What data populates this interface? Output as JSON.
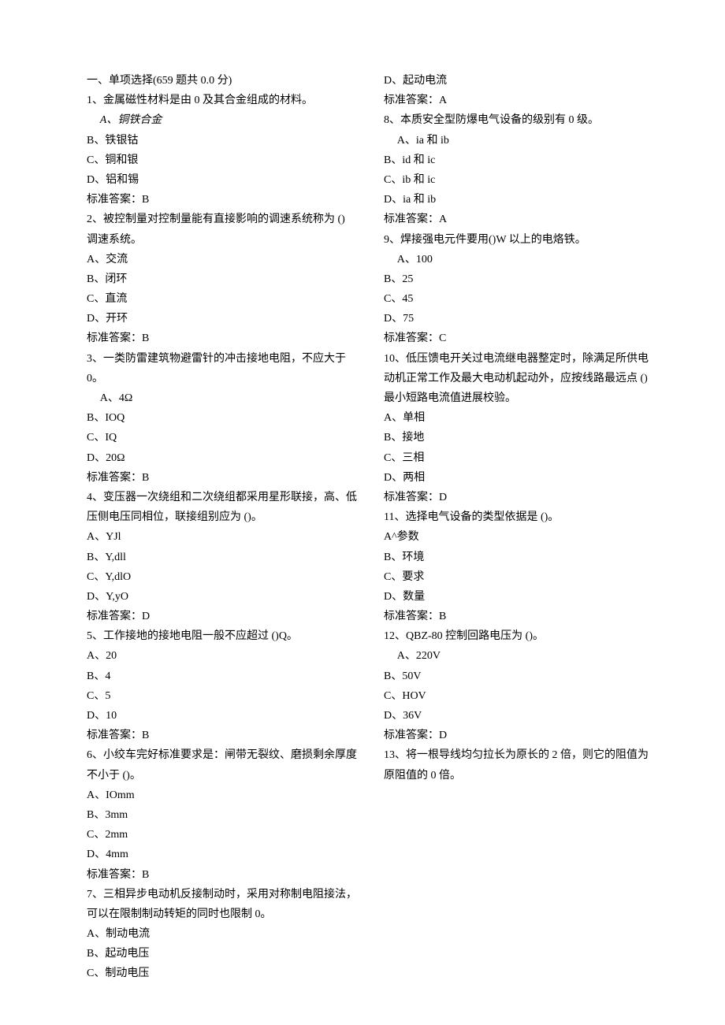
{
  "header": "一、单项选择(659 题共 0.0 分)",
  "questions": [
    {
      "stem": "1、金属磁性材料是由 0 及其合金组成的材料。",
      "options": [
        "A、铜铁合金",
        "B、铁银钴",
        "C、铜和银",
        "D、铝和锡"
      ],
      "first_indent": true,
      "first_italic": true,
      "answer": "标准答案：B"
    },
    {
      "stem": "2、被控制量对控制量能有直接影响的调速系统称为 () 调速系统。",
      "options": [
        "A、交流",
        "B、闭环",
        "C、直流",
        "D、开环"
      ],
      "answer": "标准答案：B"
    },
    {
      "stem": "3、一类防雷建筑物避雷针的冲击接地电阻，不应大于 0。",
      "options": [
        "A、4Ω",
        "B、IOQ",
        "C、IQ",
        "D、20Ω"
      ],
      "first_indent": true,
      "answer": "标准答案：B"
    },
    {
      "stem": "4、变压器一次绕组和二次绕组都采用星形联接，高、低压侧电压同相位，联接组别应为 ()。",
      "options": [
        "A、YJl",
        "B、Y,dll",
        "C、Y,dlO",
        "D、Y,yO"
      ],
      "answer": "标准答案：D"
    },
    {
      "stem": "5、工作接地的接地电阻一般不应超过 ()Q。",
      "options": [
        "A、20",
        "B、4",
        "C、5",
        "D、10"
      ],
      "answer": "标准答案：B"
    },
    {
      "stem": "6、小绞车完好标准要求是：闸带无裂纹、磨损剩余厚度不小于 ()。",
      "options": [
        "A、IOmm",
        "B、3mm",
        "C、2mm",
        "D、4mm"
      ],
      "answer": "标准答案：B"
    },
    {
      "stem": "7、三相异步电动机反接制动时，采用对称制电阻接法，可以在限制制动转矩的同时也限制 0。",
      "options": [
        "A、制动电流",
        "B、起动电压",
        "C、制动电压",
        "D、起动电流"
      ],
      "answer": "标准答案：A"
    },
    {
      "stem": "8、本质安全型防爆电气设备的级别有 0 级。",
      "options": [
        "A、ia 和 ib",
        "B、id 和 ic",
        "C、ib 和 ic",
        "D、ia 和 ib"
      ],
      "first_indent": true,
      "answer": "标准答案：A"
    },
    {
      "stem": "9、焊接强电元件要用()W 以上的电烙铁。",
      "options": [
        "A、100",
        "B、25",
        "C、45",
        "D、75"
      ],
      "first_indent": true,
      "answer": "标准答案：C"
    },
    {
      "stem": "10、低压馈电开关过电流继电器整定时，除满足所供电动机正常工作及最大电动机起动外，应按线路最远点 () 最小短路电流值进展校验。",
      "options": [
        "A、单相",
        "B、接地",
        "C、三相",
        "D、两相"
      ],
      "answer": "标准答案：D"
    },
    {
      "stem": "11、选择电气设备的类型依据是 ()。",
      "options": [
        "A^参数",
        "B、环境",
        "C、要求",
        "D、数量"
      ],
      "answer": "标准答案：B"
    },
    {
      "stem": "12、QBZ-80 控制回路电压为 ()。",
      "options": [
        "A、220V",
        "B、50V",
        "C、HOV",
        "D、36V"
      ],
      "first_indent": true,
      "answer": "标准答案：D"
    },
    {
      "stem": "13、将一根导线均匀拉长为原长的 2 倍，则它的阻值为原阻值的 0 倍。",
      "options": [],
      "answer": ""
    }
  ]
}
